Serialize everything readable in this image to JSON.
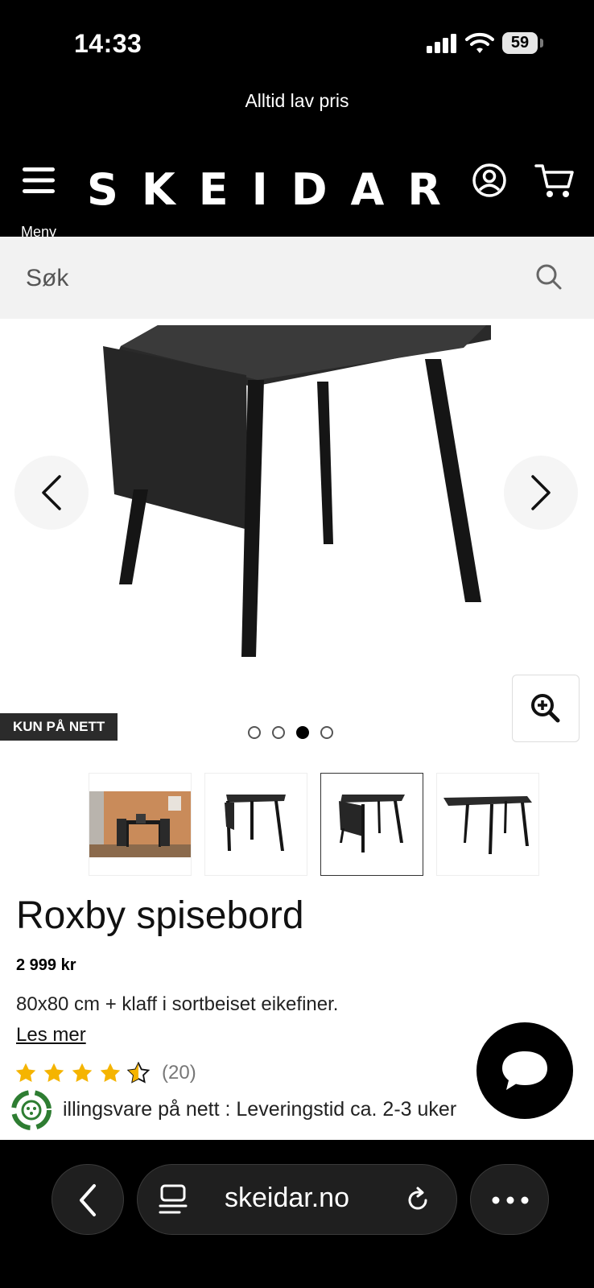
{
  "status_bar": {
    "time": "14:33",
    "battery": "59"
  },
  "promo": {
    "text": "Alltid lav pris"
  },
  "header": {
    "logo": "SKEIDAR",
    "menu_label": "Meny"
  },
  "search": {
    "placeholder": "Søk"
  },
  "gallery": {
    "badge": "KUN PÅ NETT",
    "active_index": 2,
    "dot_count": 4
  },
  "product": {
    "title": "Roxby spisebord",
    "price": "2 999 kr",
    "description": "80x80 cm + klaff i sortbeiset eikefiner.",
    "read_more": "Les mer",
    "rating": 4.5,
    "rating_count": "(20)",
    "delivery": "illingsvare på nett : Leveringstid ca. 2-3 uker"
  },
  "browser": {
    "url": "skeidar.no"
  },
  "colors": {
    "background": "#000000",
    "star": "#f5b400",
    "eco": "#2e7d32"
  }
}
